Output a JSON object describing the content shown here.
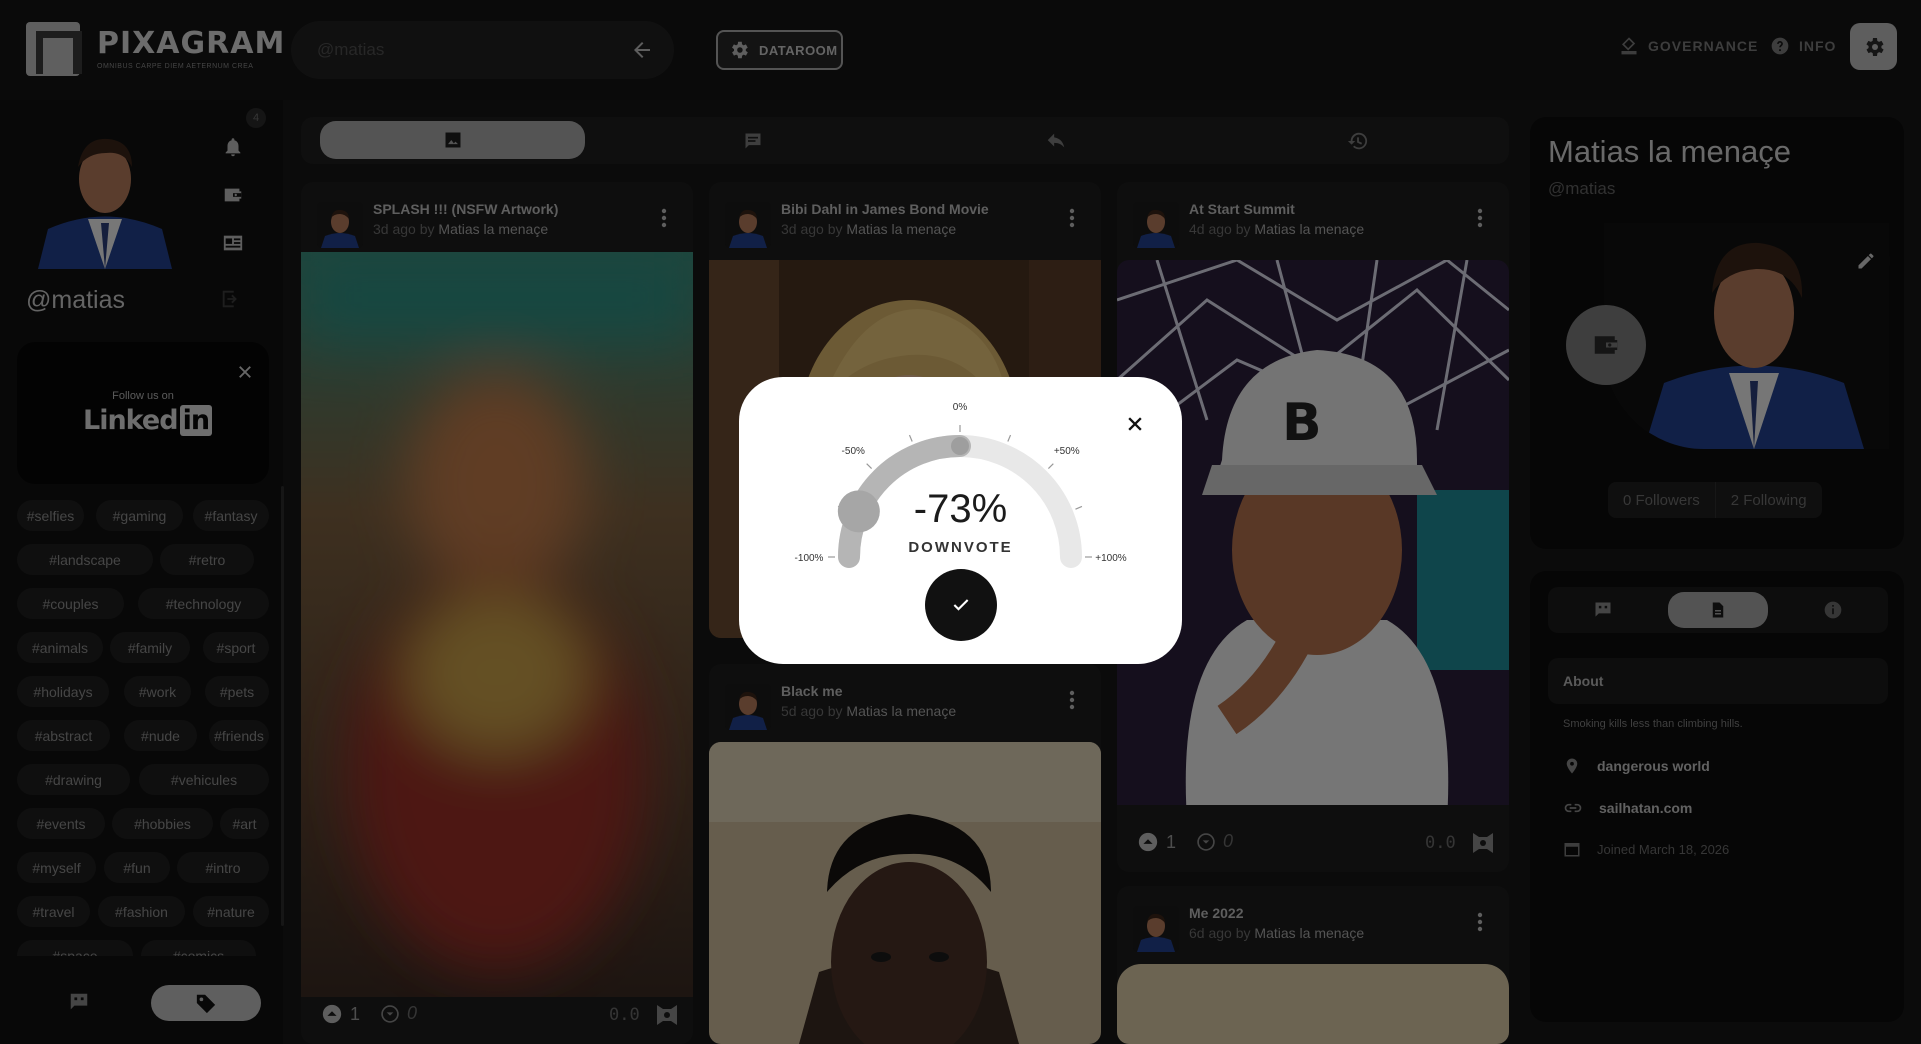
{
  "app": {
    "name": "PIXAGRAM",
    "tagline": "OMNIBUS CARPE DIEM AETERNUM CREA"
  },
  "search": {
    "placeholder": "@matias"
  },
  "header": {
    "dataroom_label": "DATAROOM",
    "governance_label": "GOVERNANCE",
    "info_label": "INFO"
  },
  "sidebar": {
    "handle": "@matias",
    "notification_count": "4",
    "follow_card": {
      "follow_text": "Follow us on",
      "brand": "Linked",
      "brand_badge": "in"
    },
    "tags": [
      "#selfies",
      "#gaming",
      "#fantasy",
      "#landscape",
      "#retro",
      "#couples",
      "#technology",
      "#animals",
      "#family",
      "#sport",
      "#holidays",
      "#work",
      "#pets",
      "#abstract",
      "#nude",
      "#friends",
      "#drawing",
      "#vehicules",
      "#events",
      "#hobbies",
      "#art",
      "#myself",
      "#fun",
      "#intro",
      "#travel",
      "#fashion",
      "#nature",
      "#space",
      "#comics"
    ]
  },
  "posts": [
    {
      "title": "SPLASH !!! (NSFW Artwork)",
      "age": "3d ago",
      "by": "by",
      "author": "Matias la menaçe",
      "upvotes": "1",
      "downvotes": "0",
      "score": "0.0"
    },
    {
      "title": "Bibi Dahl in James Bond Movie",
      "age": "3d ago",
      "by": "by",
      "author": "Matias la menaçe"
    },
    {
      "title": "At Start Summit",
      "age": "4d ago",
      "by": "by",
      "author": "Matias la menaçe",
      "upvotes": "1",
      "downvotes": "0",
      "score": "0.0"
    },
    {
      "title": "Black me",
      "age": "5d ago",
      "by": "by",
      "author": "Matias la menaçe"
    },
    {
      "title": "Me 2022",
      "age": "6d ago",
      "by": "by",
      "author": "Matias la menaçe"
    }
  ],
  "profile": {
    "name": "Matias la menaçe",
    "handle": "@matias",
    "followers": "0 Followers",
    "following": "2 Following",
    "about_title": "About",
    "bio": "Smoking kills less than climbing hills.",
    "location": "dangerous world",
    "website": "sailhatan.com",
    "joined": "Joined March 18, 2026"
  },
  "vote_modal": {
    "value": "-73%",
    "label": "DOWNVOTE",
    "value_fraction": -0.73,
    "ticks": [
      "-100%",
      "-50%",
      "0%",
      "+50%",
      "+100%"
    ]
  },
  "icons": {
    "bell": "bell-icon",
    "wallet": "wallet-icon",
    "news": "newspaper-icon",
    "logout": "logout-icon",
    "close": "close-icon",
    "tag": "tag-icon",
    "chat": "chat-icon",
    "image": "image-icon",
    "reply": "reply-icon",
    "history": "history-icon",
    "more": "more-vertical-icon",
    "upvote": "upvote-icon",
    "downvote": "downvote-icon",
    "edit": "pencil-icon",
    "location": "location-pin-icon",
    "link": "link-icon",
    "calendar": "calendar-icon",
    "check": "check-icon",
    "settings": "gear-icon",
    "help": "help-icon",
    "governance": "governance-icon",
    "dataroom": "dataroom-gear-icon",
    "back": "arrow-left-icon",
    "document": "document-icon"
  },
  "colors": {
    "accent": "#bfbfbf",
    "background": "#171717",
    "modal": "#ffffff"
  }
}
